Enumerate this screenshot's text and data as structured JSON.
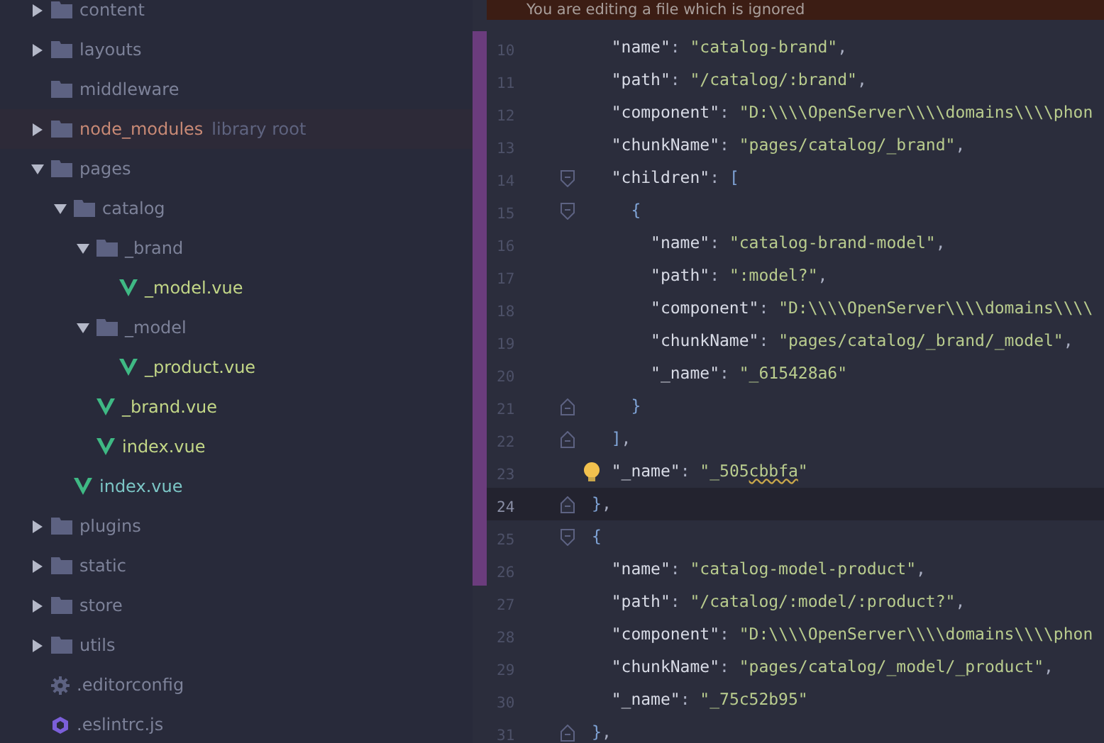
{
  "tree": [
    {
      "name": "content",
      "kind": "folder",
      "expanded": false
    },
    {
      "name": "layouts",
      "kind": "folder",
      "expanded": false
    },
    {
      "name": "middleware",
      "kind": "folder"
    },
    {
      "name": "node_modules",
      "kind": "library_folder",
      "hint": "library root",
      "expanded": false
    },
    {
      "name": "pages",
      "kind": "folder",
      "expanded": true,
      "children": [
        {
          "name": "catalog",
          "kind": "folder",
          "expanded": true,
          "children": [
            {
              "name": "_brand",
              "kind": "folder",
              "expanded": true,
              "children": [
                {
                  "name": "_model.vue",
                  "kind": "vue",
                  "color": "#c3d787"
                }
              ]
            },
            {
              "name": "_model",
              "kind": "folder",
              "expanded": true,
              "children": [
                {
                  "name": "_product.vue",
                  "kind": "vue",
                  "color": "#c3d787"
                }
              ]
            },
            {
              "name": "_brand.vue",
              "kind": "vue",
              "color": "#c3d787"
            },
            {
              "name": "index.vue",
              "kind": "vue",
              "color": "#c3d787"
            }
          ]
        },
        {
          "name": "index.vue",
          "kind": "vue",
          "color": "#7cc6c6"
        }
      ]
    },
    {
      "name": "plugins",
      "kind": "folder",
      "expanded": false
    },
    {
      "name": "static",
      "kind": "folder",
      "expanded": false
    },
    {
      "name": "store",
      "kind": "folder",
      "expanded": false
    },
    {
      "name": "utils",
      "kind": "folder",
      "expanded": false
    },
    {
      "name": ".editorconfig",
      "kind": "config"
    },
    {
      "name": ".eslintrc.js",
      "kind": "eslint"
    }
  ],
  "banner": {
    "text": "You are editing a file which is ignored"
  },
  "editor": {
    "lines": [
      {
        "number": "10",
        "kind": "plain",
        "changed": true,
        "tokens": [
          {
            "kind": "key",
            "s": "  \"name\""
          },
          {
            "kind": "punct",
            "s": ": "
          },
          {
            "kind": "string",
            "s": "\"catalog-brand\""
          },
          {
            "kind": "punct",
            "s": ","
          }
        ]
      },
      {
        "number": "11",
        "kind": "plain",
        "changed": true,
        "tokens": [
          {
            "kind": "key",
            "s": "  \"path\""
          },
          {
            "kind": "punct",
            "s": ": "
          },
          {
            "kind": "string",
            "s": "\"/catalog/:brand\""
          },
          {
            "kind": "punct",
            "s": ","
          }
        ]
      },
      {
        "number": "12",
        "kind": "plain",
        "changed": true,
        "tokens": [
          {
            "kind": "key",
            "s": "  \"component\""
          },
          {
            "kind": "punct",
            "s": ": "
          },
          {
            "kind": "string",
            "s": "\"D:\\\\\\\\OpenServer\\\\\\\\domains\\\\\\\\phon"
          }
        ]
      },
      {
        "number": "13",
        "kind": "plain",
        "changed": true,
        "tokens": [
          {
            "kind": "key",
            "s": "  \"chunkName\""
          },
          {
            "kind": "punct",
            "s": ": "
          },
          {
            "kind": "string",
            "s": "\"pages/catalog/_brand\""
          },
          {
            "kind": "punct",
            "s": ","
          }
        ]
      },
      {
        "number": "14",
        "kind": "fold_start",
        "changed": true,
        "tokens": [
          {
            "kind": "key",
            "s": "  \"children\""
          },
          {
            "kind": "punct",
            "s": ": "
          },
          {
            "kind": "bracket",
            "s": "["
          }
        ]
      },
      {
        "number": "15",
        "kind": "fold_start",
        "changed": true,
        "tokens": [
          {
            "kind": "bracket",
            "s": "    {"
          }
        ]
      },
      {
        "number": "16",
        "kind": "plain",
        "changed": true,
        "tokens": [
          {
            "kind": "key",
            "s": "      \"name\""
          },
          {
            "kind": "punct",
            "s": ": "
          },
          {
            "kind": "string",
            "s": "\"catalog-brand-model\""
          },
          {
            "kind": "punct",
            "s": ","
          }
        ]
      },
      {
        "number": "17",
        "kind": "plain",
        "changed": true,
        "tokens": [
          {
            "kind": "key",
            "s": "      \"path\""
          },
          {
            "kind": "punct",
            "s": ": "
          },
          {
            "kind": "string",
            "s": "\":model?\""
          },
          {
            "kind": "punct",
            "s": ","
          }
        ]
      },
      {
        "number": "18",
        "kind": "plain",
        "changed": true,
        "tokens": [
          {
            "kind": "key",
            "s": "      \"component\""
          },
          {
            "kind": "punct",
            "s": ": "
          },
          {
            "kind": "string",
            "s": "\"D:\\\\\\\\OpenServer\\\\\\\\domains\\\\\\\\"
          }
        ]
      },
      {
        "number": "19",
        "kind": "plain",
        "changed": true,
        "tokens": [
          {
            "kind": "key",
            "s": "      \"chunkName\""
          },
          {
            "kind": "punct",
            "s": ": "
          },
          {
            "kind": "string",
            "s": "\"pages/catalog/_brand/_model\""
          },
          {
            "kind": "punct",
            "s": ","
          }
        ]
      },
      {
        "number": "20",
        "kind": "plain",
        "changed": true,
        "tokens": [
          {
            "kind": "key",
            "s": "      \"_name\""
          },
          {
            "kind": "punct",
            "s": ": "
          },
          {
            "kind": "string",
            "s": "\"_615428a6\""
          }
        ]
      },
      {
        "number": "21",
        "kind": "fold_end",
        "changed": true,
        "tokens": [
          {
            "kind": "bracket",
            "s": "    }"
          }
        ]
      },
      {
        "number": "22",
        "kind": "fold_end",
        "changed": true,
        "tokens": [
          {
            "kind": "bracket",
            "s": "  ]"
          },
          {
            "kind": "punct",
            "s": ","
          }
        ]
      },
      {
        "number": "23",
        "kind": "plain",
        "changed": true,
        "bulb": true,
        "tokens": [
          {
            "kind": "key",
            "s": "  \"_name\""
          },
          {
            "kind": "punct",
            "s": ": "
          },
          {
            "kind": "string",
            "s": "\"_505"
          },
          {
            "kind": "warn",
            "s": "cbbfa"
          },
          {
            "kind": "string",
            "s": "\""
          }
        ]
      },
      {
        "number": "24",
        "kind": "fold_end",
        "changed": true,
        "current": true,
        "tokens": [
          {
            "kind": "bracket",
            "s": "}"
          },
          {
            "kind": "punct",
            "s": ","
          }
        ]
      },
      {
        "number": "25",
        "kind": "fold_start",
        "changed": true,
        "tokens": [
          {
            "kind": "bracket",
            "s": "{"
          }
        ]
      },
      {
        "number": "26",
        "kind": "plain",
        "changed": true,
        "tokens": [
          {
            "kind": "key",
            "s": "  \"name\""
          },
          {
            "kind": "punct",
            "s": ": "
          },
          {
            "kind": "string",
            "s": "\"catalog-model-product\""
          },
          {
            "kind": "punct",
            "s": ","
          }
        ]
      },
      {
        "number": "27",
        "kind": "plain",
        "changed": false,
        "tokens": [
          {
            "kind": "key",
            "s": "  \"path\""
          },
          {
            "kind": "punct",
            "s": ": "
          },
          {
            "kind": "string",
            "s": "\"/catalog/:model/:product?\""
          },
          {
            "kind": "punct",
            "s": ","
          }
        ]
      },
      {
        "number": "28",
        "kind": "plain",
        "changed": false,
        "tokens": [
          {
            "kind": "key",
            "s": "  \"component\""
          },
          {
            "kind": "punct",
            "s": ": "
          },
          {
            "kind": "string",
            "s": "\"D:\\\\\\\\OpenServer\\\\\\\\domains\\\\\\\\phon"
          }
        ]
      },
      {
        "number": "29",
        "kind": "plain",
        "changed": false,
        "tokens": [
          {
            "kind": "key",
            "s": "  \"chunkName\""
          },
          {
            "kind": "punct",
            "s": ": "
          },
          {
            "kind": "string",
            "s": "\"pages/catalog/_model/_product\""
          },
          {
            "kind": "punct",
            "s": ","
          }
        ]
      },
      {
        "number": "30",
        "kind": "plain",
        "changed": false,
        "tokens": [
          {
            "kind": "key",
            "s": "  \"_name\""
          },
          {
            "kind": "punct",
            "s": ": "
          },
          {
            "kind": "string",
            "s": "\"_75c52b95\""
          }
        ]
      },
      {
        "number": "31",
        "kind": "fold_end",
        "changed": false,
        "tokens": [
          {
            "kind": "bracket",
            "s": "}"
          },
          {
            "kind": "punct",
            "s": ","
          }
        ]
      }
    ]
  }
}
